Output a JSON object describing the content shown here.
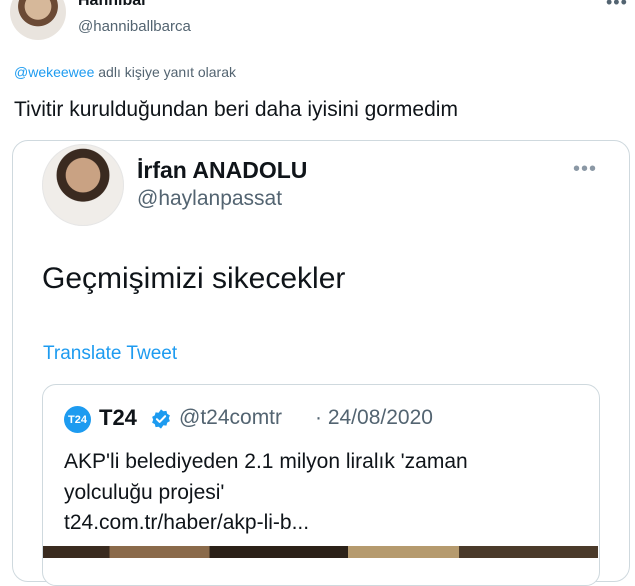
{
  "tweet": {
    "author_name": "Hannibal",
    "author_handle": "@hanniballbarca",
    "reply_mention": "@wekeewee",
    "reply_suffix": "adlı kişiye yanıt olarak",
    "text": "Tivitir kurulduğundan beri daha iyisini gormedim",
    "more_label": "•••"
  },
  "embedded": {
    "author_name": "İrfan ANADOLU",
    "author_handle": "@haylanpassat",
    "text": "Geçmişimizi sikecekler",
    "translate_label": "Translate Tweet",
    "more_label": "•••",
    "quote": {
      "logo_text": "T24",
      "name": "T24",
      "handle": "@t24comtr",
      "date": "· 24/08/2020",
      "line1": "AKP'li belediyeden 2.1 milyon liralık 'zaman",
      "line2": "yolculuğu projesi'",
      "line3": "t24.com.tr/haber/akp-li-b..."
    }
  },
  "colors": {
    "link": "#1d9bf0",
    "secondary_text": "#536471",
    "border": "#cfd9de"
  },
  "icons": {
    "verified": "verified-badge-icon",
    "more": "more-horizontal-icon"
  }
}
